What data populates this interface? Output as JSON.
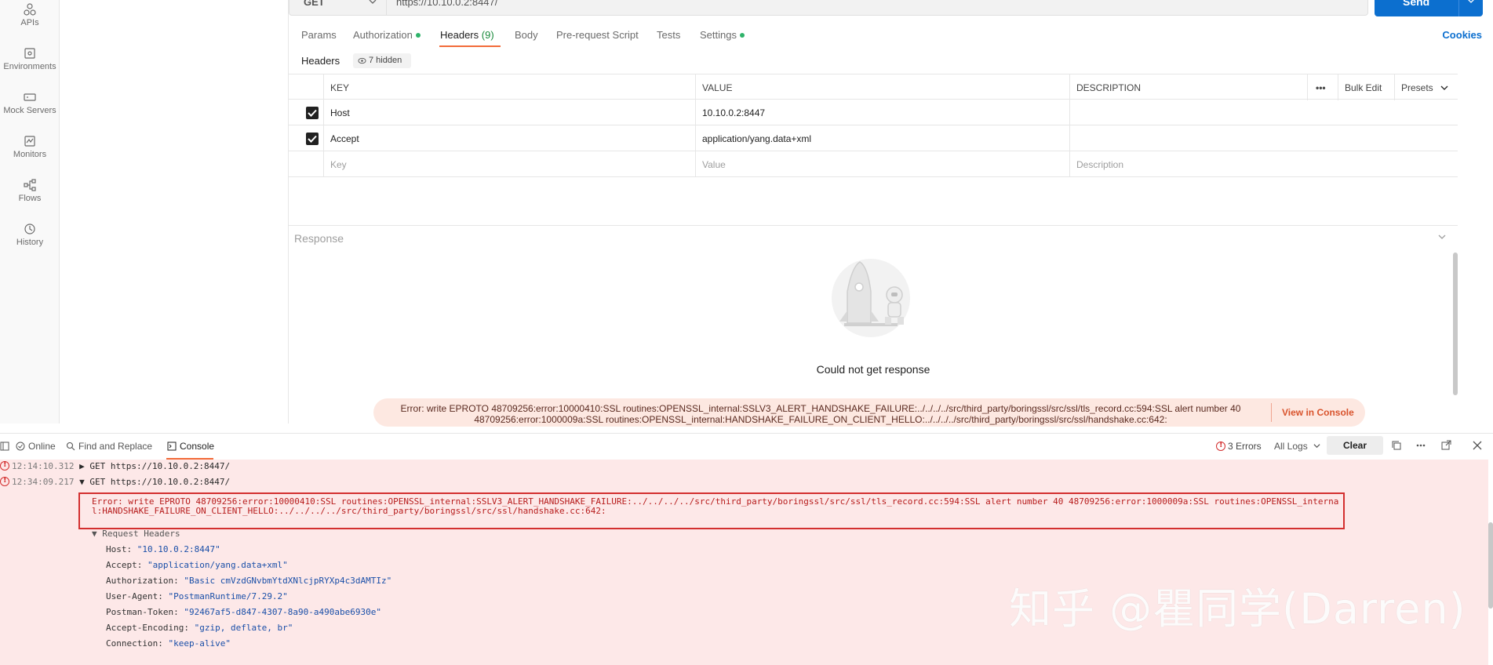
{
  "sidebar": {
    "items": [
      {
        "label": "APIs",
        "icon": "apis-icon"
      },
      {
        "label": "Environments",
        "icon": "environments-icon"
      },
      {
        "label": "Mock Servers",
        "icon": "mock-servers-icon"
      },
      {
        "label": "Monitors",
        "icon": "monitors-icon"
      },
      {
        "label": "Flows",
        "icon": "flows-icon"
      },
      {
        "label": "History",
        "icon": "history-icon"
      }
    ]
  },
  "request": {
    "method": "GET",
    "url": "https://10.10.0.2:8447/",
    "send_label": "Send"
  },
  "tabs": {
    "items": [
      {
        "label": "Params"
      },
      {
        "label": "Authorization",
        "dot": true
      },
      {
        "label": "Headers",
        "count": "(9)",
        "active": true
      },
      {
        "label": "Body"
      },
      {
        "label": "Pre-request Script"
      },
      {
        "label": "Tests"
      },
      {
        "label": "Settings",
        "dot": true
      }
    ],
    "cookies": "Cookies"
  },
  "headers_section": {
    "title": "Headers",
    "hidden_badge": "7 hidden"
  },
  "headers_table": {
    "columns": {
      "key": "KEY",
      "value": "VALUE",
      "description": "DESCRIPTION",
      "more": "•••",
      "bulk_edit": "Bulk Edit",
      "presets": "Presets"
    },
    "rows": [
      {
        "key": "Host",
        "value": "10.10.0.2:8447",
        "description": "",
        "checked": true
      },
      {
        "key": "Accept",
        "value": "application/yang.data+xml",
        "description": "",
        "checked": true
      }
    ],
    "placeholders": {
      "key": "Key",
      "value": "Value",
      "description": "Description"
    }
  },
  "response": {
    "title": "Response",
    "message": "Could not get response",
    "error_line1": "Error: write EPROTO 48709256:error:10000410:SSL routines:OPENSSL_internal:SSLV3_ALERT_HANDSHAKE_FAILURE:../../../../src/third_party/boringssl/src/ssl/tls_record.cc:594:SSL alert number 40",
    "error_line2": "48709256:error:1000009a:SSL routines:OPENSSL_internal:HANDSHAKE_FAILURE_ON_CLIENT_HELLO:../../../../src/third_party/boringssl/src/ssl/handshake.cc:642:",
    "view_console": "View in Console"
  },
  "console": {
    "toolbar": {
      "online": "Online",
      "find_replace": "Find and Replace",
      "console": "Console",
      "errors": "3 Errors",
      "all_logs": "All Logs",
      "clear": "Clear"
    },
    "logs": [
      {
        "time": "12:14:10.312",
        "arrow": "▶",
        "text": "GET https://10.10.0.2:8447/"
      },
      {
        "time": "12:34:09.217",
        "arrow": "▼",
        "text": "GET https://10.10.0.2:8447/"
      }
    ],
    "error_text": "Error: write EPROTO 48709256:error:10000410:SSL routines:OPENSSL_internal:SSLV3_ALERT_HANDSHAKE_FAILURE:../../../../src/third_party/boringssl/src/ssl/tls_record.cc:594:SSL alert number 40 48709256:error:1000009a:SSL routines:OPENSSL_internal:HANDSHAKE_FAILURE_ON_CLIENT_HELLO:../../../../src/third_party/boringssl/src/ssl/handshake.cc:642:",
    "request_headers_label": "▼ Request Headers",
    "request_headers": [
      {
        "k": "Host: ",
        "v": "\"10.10.0.2:8447\""
      },
      {
        "k": "Accept: ",
        "v": "\"application/yang.data+xml\""
      },
      {
        "k": "Authorization: ",
        "v": "\"Basic cmVzdGNvbmYtdXNlcjpRYXp4c3dAMTIz\""
      },
      {
        "k": "User-Agent: ",
        "v": "\"PostmanRuntime/7.29.2\""
      },
      {
        "k": "Postman-Token: ",
        "v": "\"92467af5-d847-4307-8a90-a490abe6930e\""
      },
      {
        "k": "Accept-Encoding: ",
        "v": "\"gzip, deflate, br\""
      },
      {
        "k": "Connection: ",
        "v": "\"keep-alive\""
      }
    ]
  },
  "watermark": "知乎 @瞿同学(Darren)",
  "colors": {
    "accent": "#f26b3a",
    "send": "#0c6fcf",
    "error": "#d32f2f",
    "console_bg": "#fde8e8"
  }
}
